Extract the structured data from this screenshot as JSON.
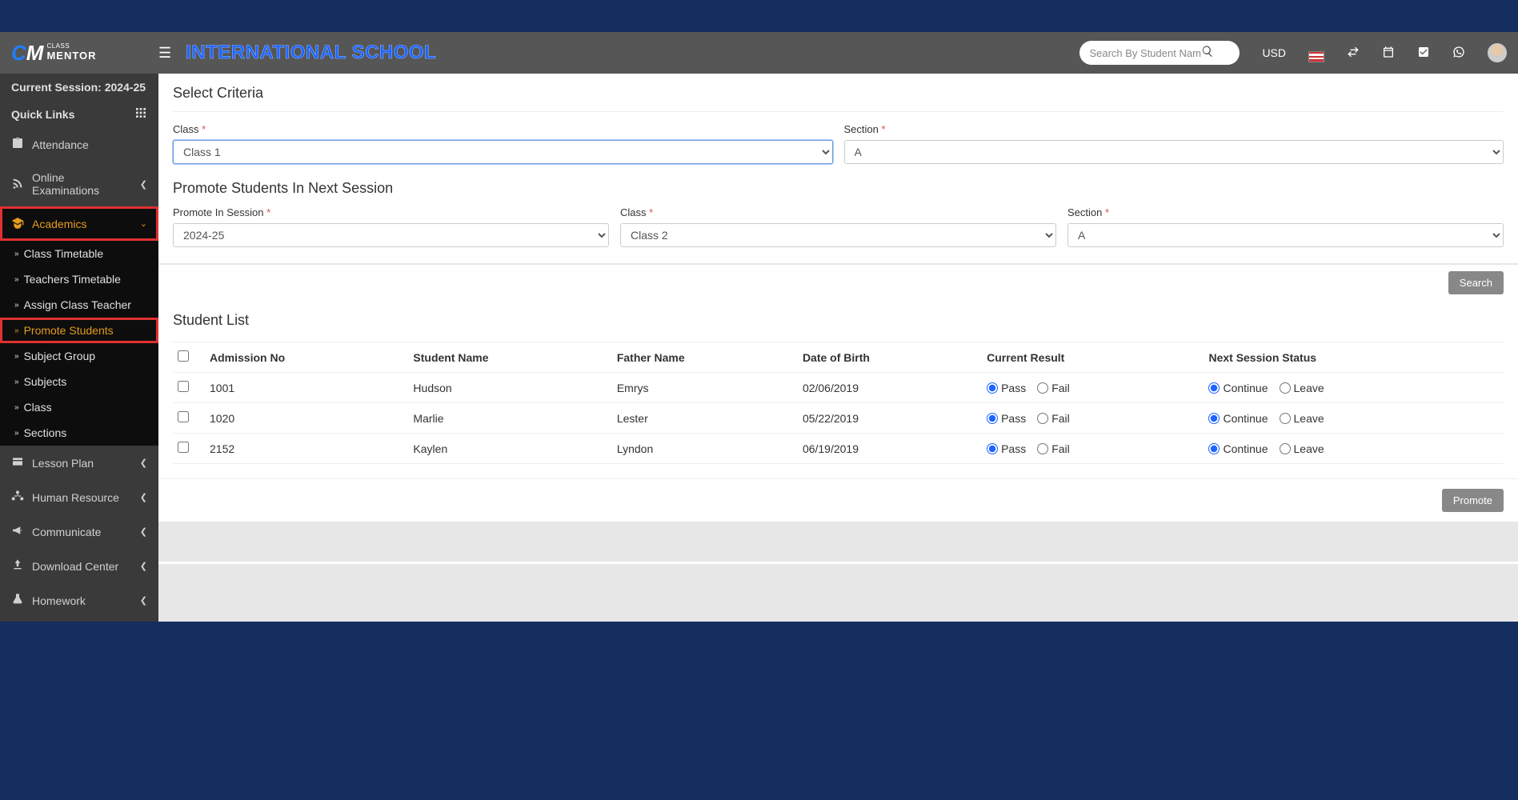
{
  "header": {
    "brand": "INTERNATIONAL SCHOOL",
    "search_placeholder": "Search By Student Name",
    "currency": "USD"
  },
  "sidebar": {
    "session_label": "Current Session: 2024-25",
    "quick_links": "Quick Links",
    "items": {
      "attendance": "Attendance",
      "online_exams": "Online Examinations",
      "academics": "Academics",
      "lesson_plan": "Lesson Plan",
      "human_resource": "Human Resource",
      "communicate": "Communicate",
      "download_center": "Download Center",
      "homework": "Homework"
    },
    "academics_sub": {
      "class_timetable": "Class Timetable",
      "teachers_timetable": "Teachers Timetable",
      "assign_class_teacher": "Assign Class Teacher",
      "promote_students": "Promote Students",
      "subject_group": "Subject Group",
      "subjects": "Subjects",
      "class": "Class",
      "sections": "Sections"
    }
  },
  "criteria": {
    "title": "Select Criteria",
    "class_label": "Class",
    "class_value": "Class 1",
    "section_label": "Section",
    "section_value": "A"
  },
  "promote": {
    "title": "Promote Students In Next Session",
    "session_label": "Promote In Session",
    "session_value": "2024-25",
    "class_label": "Class",
    "class_value": "Class 2",
    "section_label": "Section",
    "section_value": "A",
    "search_btn": "Search"
  },
  "list": {
    "title": "Student List",
    "cols": {
      "admission": "Admission No",
      "student": "Student Name",
      "father": "Father Name",
      "dob": "Date of Birth",
      "result": "Current Result",
      "status": "Next Session Status"
    },
    "result_opts": {
      "pass": "Pass",
      "fail": "Fail"
    },
    "status_opts": {
      "continue": "Continue",
      "leave": "Leave"
    },
    "rows": [
      {
        "admission": "1001",
        "student": "Hudson",
        "father": "Emrys",
        "dob": "02/06/2019"
      },
      {
        "admission": "1020",
        "student": "Marlie",
        "father": "Lester",
        "dob": "05/22/2019"
      },
      {
        "admission": "2152",
        "student": "Kaylen",
        "father": "Lyndon",
        "dob": "06/19/2019"
      }
    ],
    "promote_btn": "Promote"
  }
}
